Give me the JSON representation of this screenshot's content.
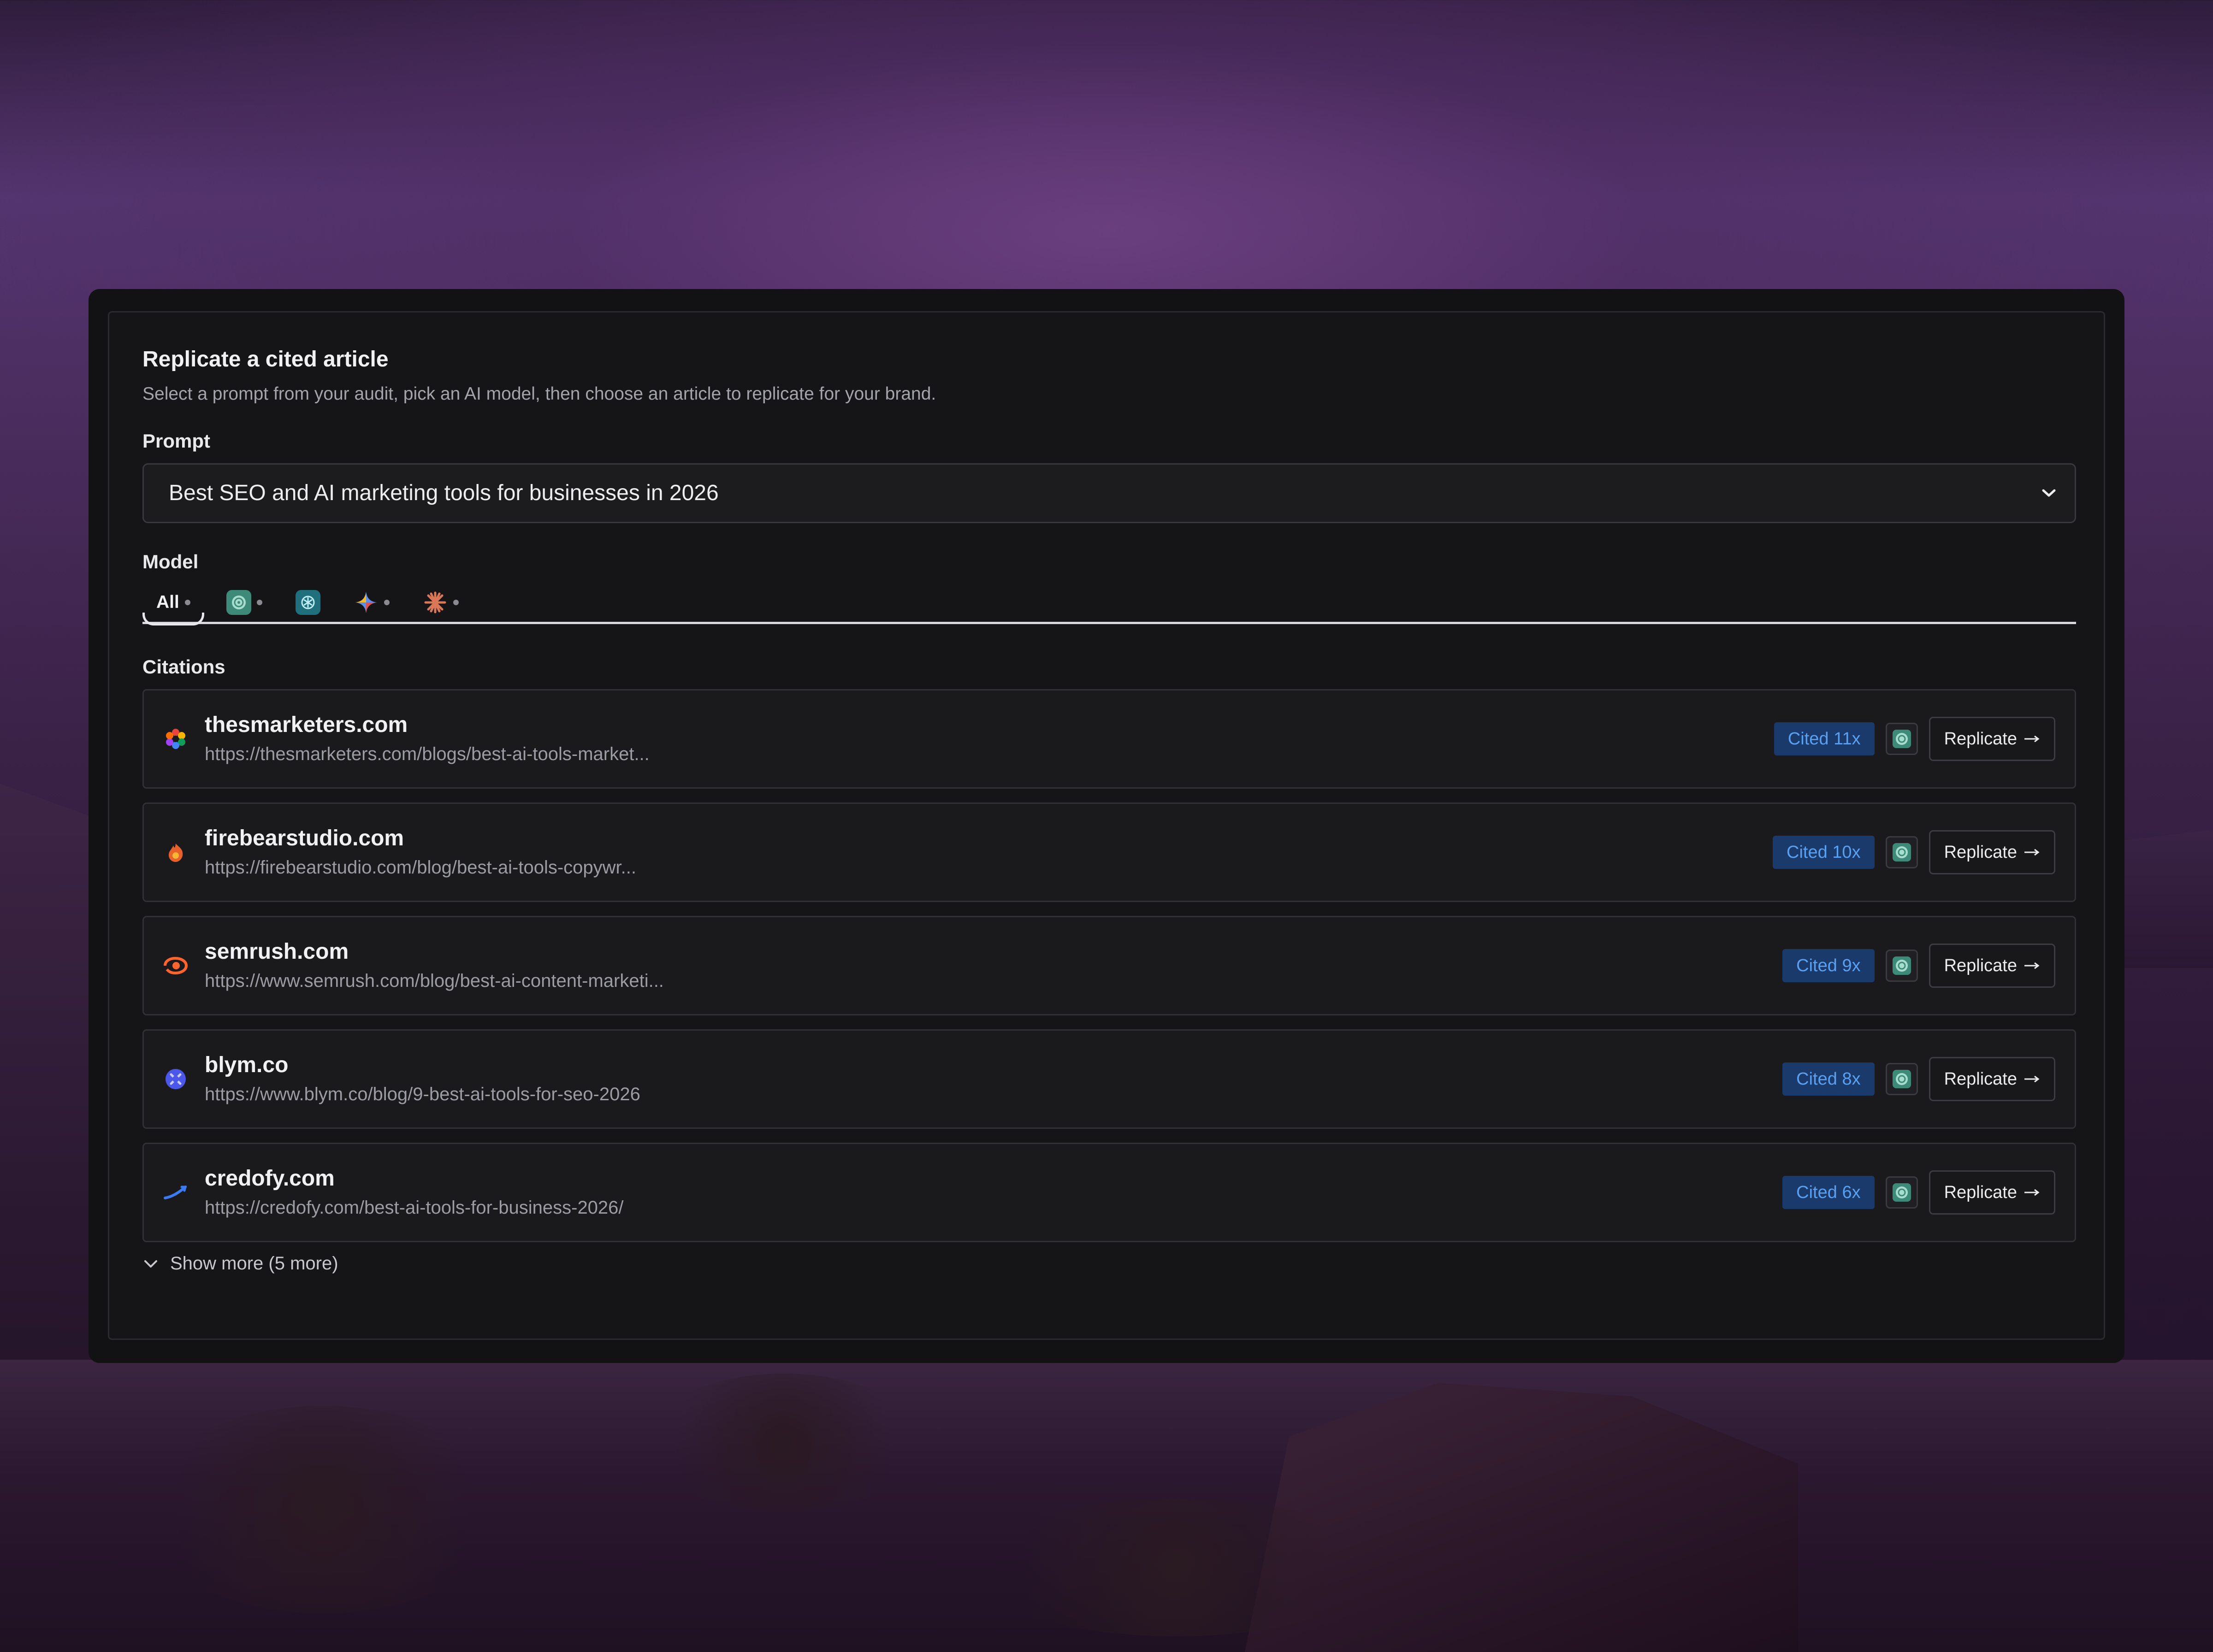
{
  "card": {
    "title": "Replicate a cited article",
    "subtitle": "Select a prompt from your audit, pick an AI model, then choose an article to replicate for your brand."
  },
  "prompt": {
    "label": "Prompt",
    "value": "Best SEO and AI marketing tools for businesses in 2026"
  },
  "model": {
    "label": "Model",
    "tabs": [
      {
        "label": "All",
        "icon": "all",
        "selected": true
      },
      {
        "label": "",
        "icon": "chatgpt-icon"
      },
      {
        "label": "",
        "icon": "perplexity-icon"
      },
      {
        "label": "",
        "icon": "gemini-icon"
      },
      {
        "label": "",
        "icon": "claude-icon"
      }
    ]
  },
  "citations": {
    "label": "Citations",
    "items": [
      {
        "domain": "thesmarketers.com",
        "url": "https://thesmarketers.com/blogs/best-ai-tools-market...",
        "badge": "Cited 11x",
        "action": "Replicate",
        "favicon": "thesmarketers-icon"
      },
      {
        "domain": "firebearstudio.com",
        "url": "https://firebearstudio.com/blog/best-ai-tools-copywr...",
        "badge": "Cited 10x",
        "action": "Replicate",
        "favicon": "firebear-icon"
      },
      {
        "domain": "semrush.com",
        "url": "https://www.semrush.com/blog/best-ai-content-marketi...",
        "badge": "Cited 9x",
        "action": "Replicate",
        "favicon": "semrush-icon"
      },
      {
        "domain": "blym.co",
        "url": "https://www.blym.co/blog/9-best-ai-tools-for-seo-2026",
        "badge": "Cited 8x",
        "action": "Replicate",
        "favicon": "blym-icon"
      },
      {
        "domain": "credofy.com",
        "url": "https://credofy.com/best-ai-tools-for-business-2026/",
        "badge": "Cited 6x",
        "action": "Replicate",
        "favicon": "credofy-icon"
      }
    ],
    "show_more": "Show more (5 more)"
  },
  "colors": {
    "badge_bg": "#1a3a6c",
    "badge_text": "#5aa0f0",
    "card_bg": "#151517"
  }
}
